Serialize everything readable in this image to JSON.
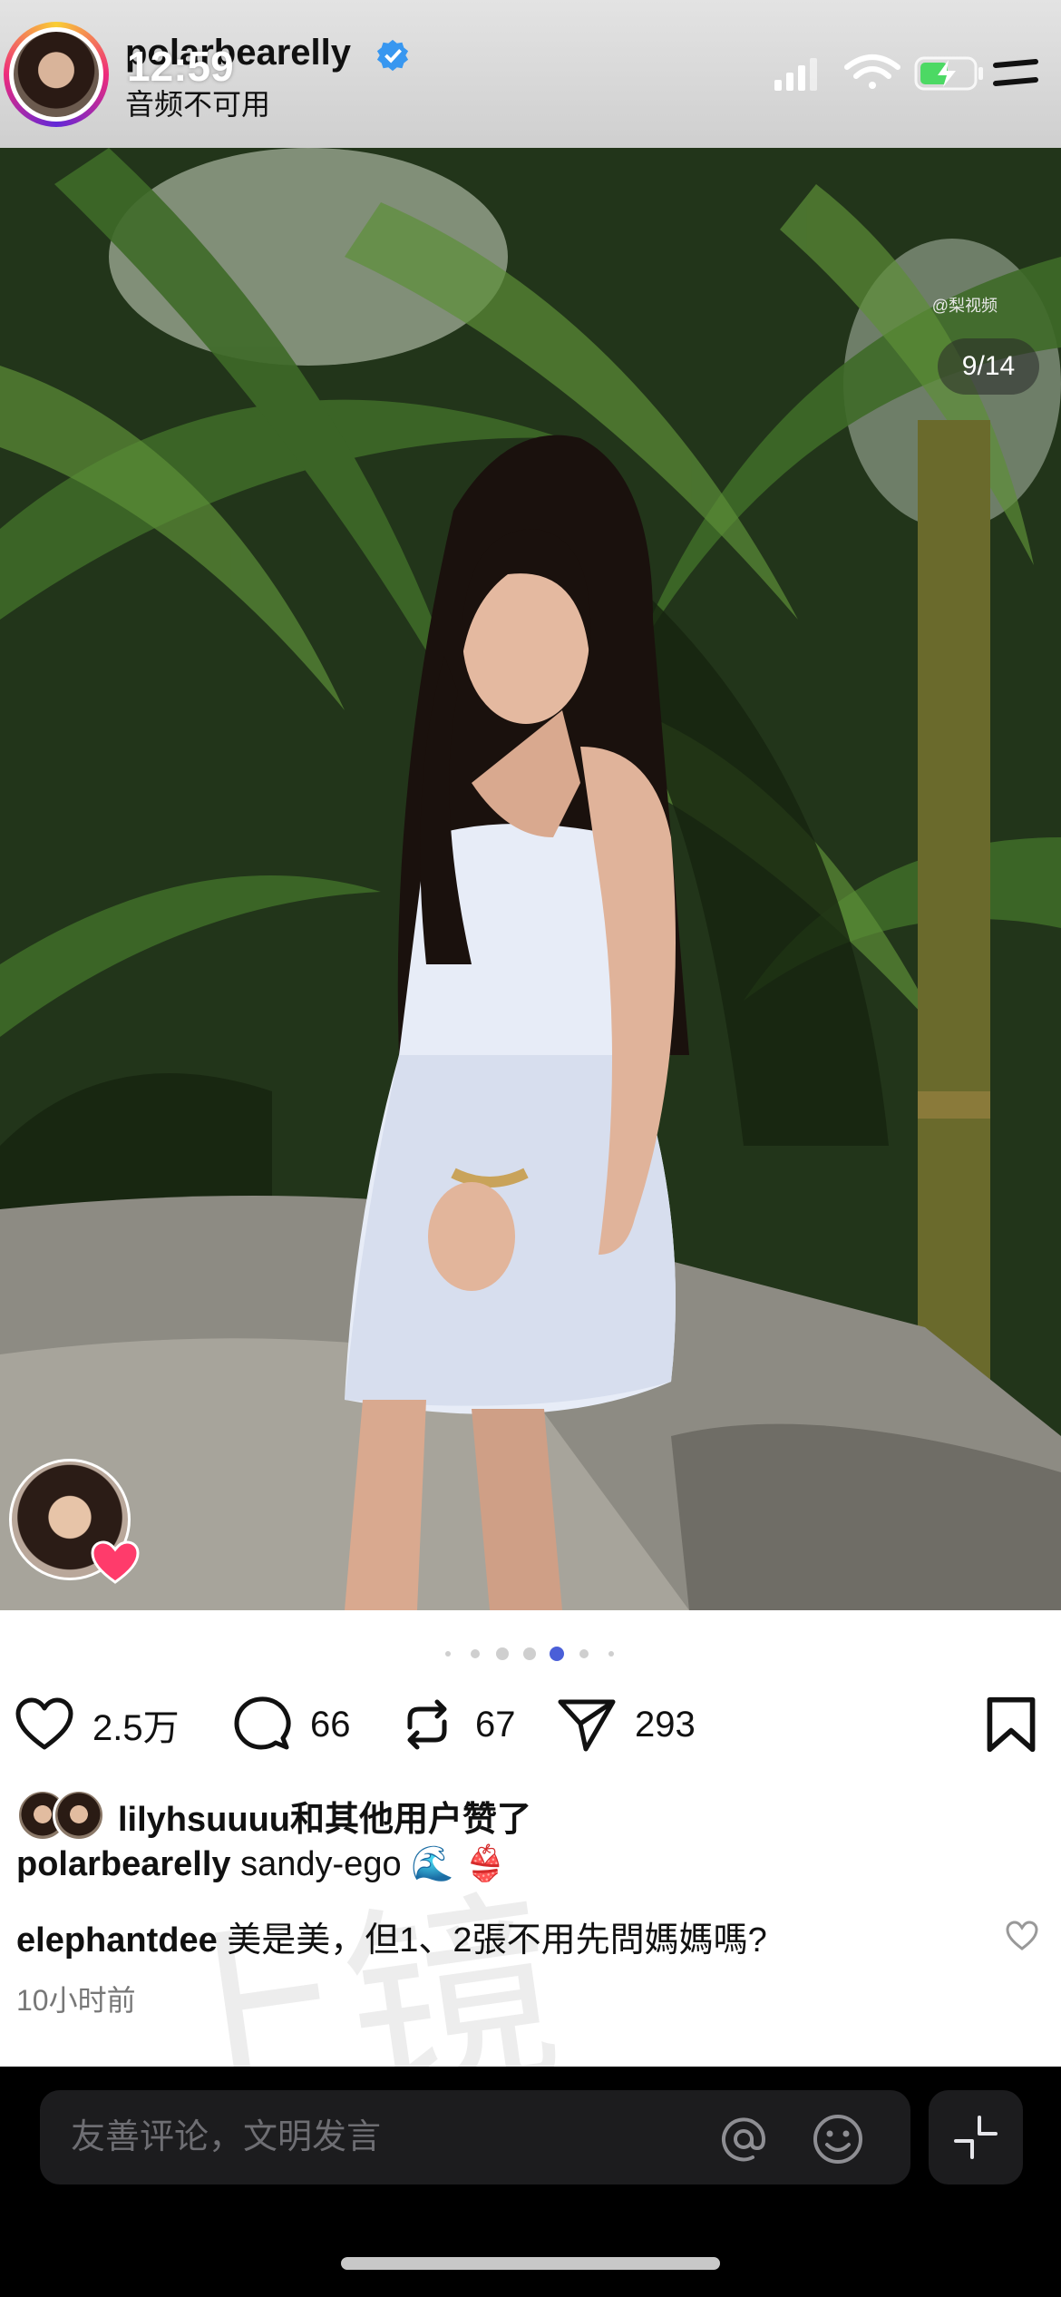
{
  "status_bar": {
    "time": "12:59"
  },
  "header": {
    "username": "polarbearelly",
    "subtitle": "音频不可用"
  },
  "post": {
    "source_watermark": "@梨视频",
    "page_counter": "9/14",
    "carousel": {
      "total_dots": 7,
      "active_index": 4
    }
  },
  "actions": {
    "likes": "2.5万",
    "comments": "66",
    "reposts": "67",
    "shares": "293"
  },
  "liked_by": {
    "user": "lilyhsuuuu",
    "suffix": "和其他用户赞了"
  },
  "caption": {
    "user": "polarbearelly",
    "text": "sandy-ego 🌊 👙"
  },
  "comment": {
    "user": "elephantdee",
    "text": "美是美，但1、2張不用先問媽媽嗎?"
  },
  "timestamp": "10小时前",
  "overlay_watermark": "上镜",
  "composer": {
    "placeholder": "友善评论，文明发言"
  },
  "colors": {
    "accent": "#4a5fd8",
    "verified": "#3897f0",
    "like_heart": "#ff3b6b"
  }
}
